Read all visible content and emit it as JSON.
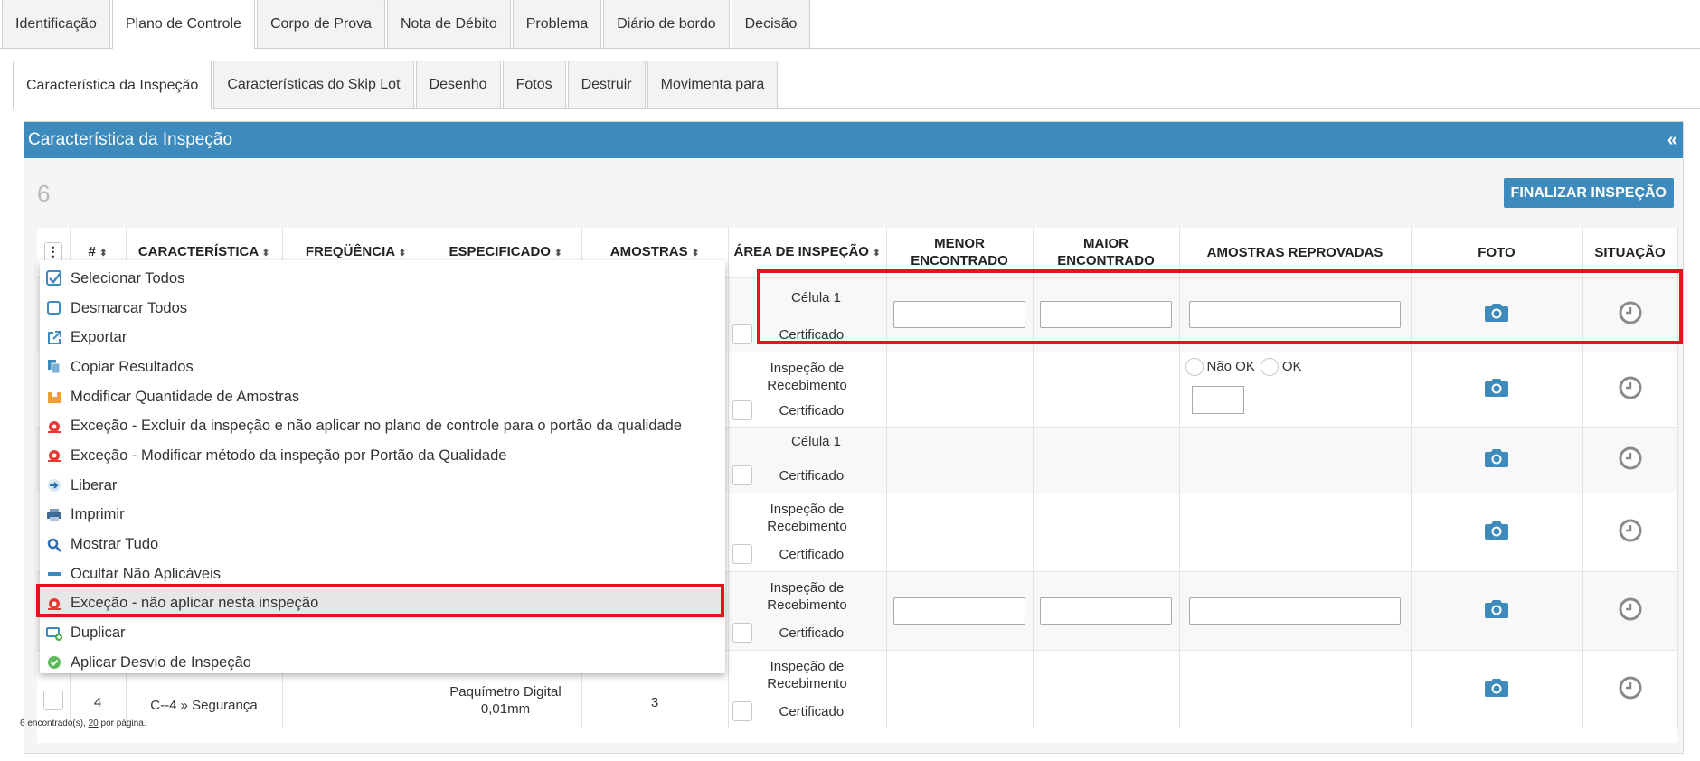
{
  "top_tabs": [
    "Identificação",
    "Plano de Controle",
    "Corpo de Prova",
    "Nota de Débito",
    "Problema",
    "Diário de bordo",
    "Decisão"
  ],
  "sub_tabs": [
    "Característica da Inspeção",
    "Características do Skip Lot",
    "Desenho",
    "Fotos",
    "Destruir",
    "Movimenta para"
  ],
  "panel": {
    "title": "Característica da Inspeção",
    "collapse_label": "«",
    "count": "6",
    "finalize_label": "FINALIZAR INSPEÇÃO"
  },
  "table": {
    "headers": {
      "num": "#",
      "caracteristica": "CARACTERÍSTICA",
      "frequencia": "FREQÜÊNCIA",
      "especificado": "ESPECIFICADO",
      "amostras": "AMOSTRAS",
      "area": "ÁREA DE INSPEÇÃO",
      "menor": "MENOR ENCONTRADO",
      "maior": "MAIOR ENCONTRADO",
      "reprovadas": "AMOSTRAS REPROVADAS",
      "foto": "FOTO",
      "situacao": "SITUAÇÃO"
    },
    "rows": [
      {
        "area_top": "Célula 1",
        "area_bottom": "Certificado"
      },
      {
        "area_top": "Inspeção de Recebimento",
        "area_bottom": "Certificado",
        "radio_nok": "Não OK",
        "radio_ok": "OK"
      },
      {
        "area_top": "Célula 1",
        "area_bottom": "Certificado"
      },
      {
        "area_top": "Inspeção de Recebimento",
        "area_bottom": "Certificado"
      },
      {
        "area_top": "Inspeção de Recebimento",
        "area_bottom": "Certificado"
      },
      {
        "num": "4",
        "caracteristica": "C--4 » Segurança",
        "especificado": "Paquímetro Digital 0,01mm",
        "amostras": "3",
        "area_top": "Inspeção de Recebimento",
        "area_bottom": "Certificado"
      }
    ],
    "footer_count": "6 encontrado(s),",
    "footer_per_page": "20",
    "footer_suffix": "por página."
  },
  "menu": {
    "items": [
      "Selecionar Todos",
      "Desmarcar Todos",
      "Exportar",
      "Copiar Resultados",
      "Modificar Quantidade de Amostras",
      "Exceção - Excluir da inspeção e não aplicar no plano de controle para o portão da qualidade",
      "Exceção - Modificar método da inspeção por Portão da Qualidade",
      "Liberar",
      "Imprimir",
      "Mostrar Tudo",
      "Ocultar Não Aplicáveis",
      "Exceção - não aplicar nesta inspeção",
      "Duplicar",
      "Aplicar Desvio de Inspeção"
    ]
  },
  "colors": {
    "accent": "#3d8bbd",
    "highlight": "#e5131c"
  }
}
